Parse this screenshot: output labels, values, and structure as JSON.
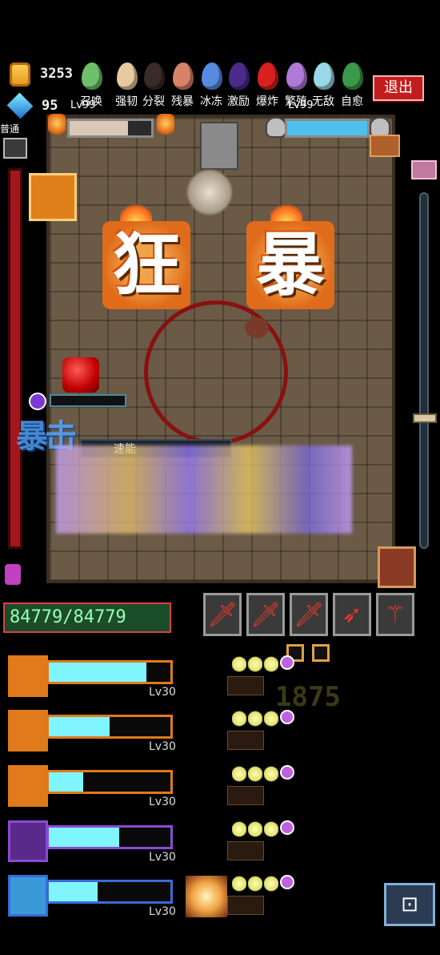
{
  "currency": {
    "gold": "3253",
    "gems": "95"
  },
  "top_bar": {
    "eggs": [
      {
        "label": "召唤",
        "color": "#6fbf6a",
        "icon": "green-egg-icon"
      },
      {
        "label": "强韧",
        "color": "#e8c9a0",
        "icon": "tan-egg-icon"
      },
      {
        "label": "分裂",
        "color": "#3a2a2a",
        "icon": "dark-egg-icon"
      },
      {
        "label": "残暴",
        "color": "#d9826a",
        "icon": "orange-egg-icon"
      },
      {
        "label": "冰冻",
        "color": "#5a8ae0",
        "icon": "blue-egg-icon"
      },
      {
        "label": "激励",
        "color": "#4a2a8a",
        "icon": "purple-egg-icon"
      },
      {
        "label": "爆炸",
        "color": "#d82020",
        "icon": "red-egg-icon"
      },
      {
        "label": "繁殖",
        "color": "#b07ad8",
        "icon": "violet-egg-icon"
      },
      {
        "label": "无敌",
        "color": "#9ad8e8",
        "icon": "cyan-egg-icon"
      },
      {
        "label": "自愈",
        "color": "#3a9a4a",
        "icon": "dark-green-egg-icon"
      }
    ],
    "exit_label": "退出"
  },
  "arena": {
    "left_boss_level": "Lv99",
    "right_boss_level": "Lv99",
    "left_boss_hp_fraction": 0.72,
    "right_boss_hp_fraction": 1.0,
    "rage_chars": [
      "狂",
      "暴"
    ],
    "side_label": "普通",
    "power_label": "速能",
    "frenzy_overlay": "暴击"
  },
  "damage_readout": "84779/84779",
  "ghost_number": "1875",
  "heroes": [
    {
      "level": "Lv30",
      "hp_fraction": 0.8,
      "border": "#e07a1a",
      "portrait_bg": "#e07a1a",
      "icon": "fire-hero-icon"
    },
    {
      "level": "Lv30",
      "hp_fraction": 0.5,
      "border": "#e07a1a",
      "portrait_bg": "#e07a1a",
      "icon": "fire-hero-icon"
    },
    {
      "level": "Lv30",
      "hp_fraction": 0.28,
      "border": "#e07a1a",
      "portrait_bg": "#e07a1a",
      "icon": "fire-hero-icon"
    },
    {
      "level": "Lv30",
      "hp_fraction": 0.58,
      "border": "#8a4ad8",
      "portrait_bg": "#5a2a8a",
      "icon": "shadow-hero-icon"
    },
    {
      "level": "Lv30",
      "hp_fraction": 0.4,
      "border": "#3a6ad8",
      "portrait_bg": "#3a9ad8",
      "icon": "ice-hero-icon"
    }
  ],
  "weapons": [
    "sword-icon",
    "sword-icon",
    "sword-icon",
    "bow-icon",
    "staff-icon"
  ],
  "colors": {
    "background": "#000000",
    "exit_red": "#c21d1d",
    "hp_cyan": "#7ff6ff"
  }
}
